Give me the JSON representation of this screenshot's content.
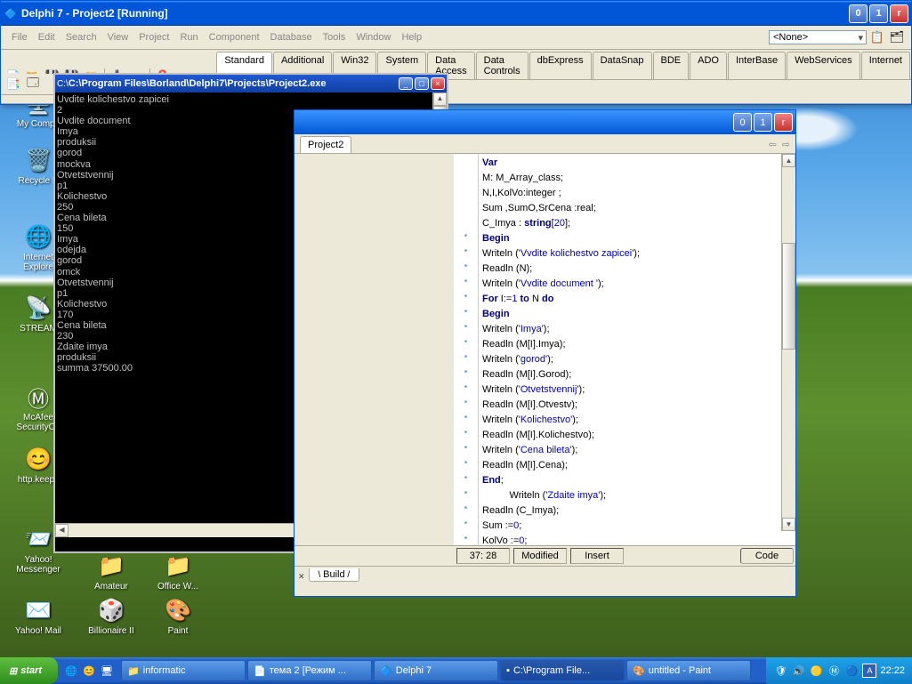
{
  "desktop": {
    "icons": [
      {
        "name": "my-computer",
        "label": "My Compu",
        "glyph": "🖥️"
      },
      {
        "name": "recycle-bin",
        "label": "Recycle B",
        "glyph": "🗑️"
      },
      {
        "name": "ie",
        "label": "Internet Explore",
        "glyph": "🌐"
      },
      {
        "name": "stream",
        "label": "STREAM",
        "glyph": "📡"
      },
      {
        "name": "mcafee",
        "label": "McAfee SecurityCe",
        "glyph": "Ⓜ"
      },
      {
        "name": "keepv",
        "label": "http.keepv",
        "glyph": "😊"
      },
      {
        "name": "ymsg",
        "label": "Yahoo! Messenger",
        "glyph": "📨"
      },
      {
        "name": "ymail",
        "label": "Yahoo! Mail",
        "glyph": "✉️"
      },
      {
        "name": "amateur",
        "label": "Amateur",
        "glyph": "📁"
      },
      {
        "name": "officew",
        "label": "Office W...",
        "glyph": "📁"
      },
      {
        "name": "billionaire",
        "label": "Billionaire II",
        "glyph": "🎲"
      },
      {
        "name": "paint",
        "label": "Paint",
        "glyph": "🎨"
      }
    ]
  },
  "delphi": {
    "title": "Delphi 7 - Project2 [Running]",
    "menu": [
      "File",
      "Edit",
      "Search",
      "View",
      "Project",
      "Run",
      "Component",
      "Database",
      "Tools",
      "Window",
      "Help"
    ],
    "dropdown": "<None>",
    "palette_tabs": [
      "Standard",
      "Additional",
      "Win32",
      "System",
      "Data Access",
      "Data Controls",
      "dbExpress",
      "DataSnap",
      "BDE",
      "ADO",
      "InterBase",
      "WebServices",
      "Internet"
    ]
  },
  "console": {
    "title": "C:\\Program Files\\Borland\\Delphi7\\Projects\\Project2.exe",
    "output": "Uvdite kolichestvo zapicei\n2\nUvdite document\nImya\nproduksii\ngorod\nmockva\nOtvetstvennij\np1\nKolichestvo\n250\nCena bileta\n150\nImya\nodejda\ngorod\nomck\nOtvetstvennij\np1\nKolichestvo\n170\nCena bileta\n230\nZdaite imya\nproduksii\nsumma 37500.00"
  },
  "editor": {
    "tab": "Project2",
    "status": {
      "pos": "37: 28",
      "mod": "Modified",
      "ins": "Insert",
      "view": "Code"
    },
    "build_tab": "Build",
    "code_lines": [
      {
        "t": "Var",
        "kw": "Var"
      },
      {
        "t": "M: M_Array_class;"
      },
      {
        "t": "N,I,KolVo:integer ;"
      },
      {
        "t": "Sum ,SumO,SrCena :real;"
      },
      {
        "t": "C_Imya : string[20];",
        "num": "20",
        "kw": "string"
      },
      {
        "t": "Begin",
        "kw": "Begin"
      },
      {
        "t": "Writeln ('Vvdite kolichestvo zapicei');",
        "str": "'Vvdite kolichestvo zapicei'"
      },
      {
        "t": "Readln (N);"
      },
      {
        "t": "Writeln ('Vvdite document ');",
        "str": "'Vvdite document '"
      },
      {
        "t": "For I:=1 to N do",
        "kw": "For",
        "kw2": "to",
        "kw3": "do",
        "num": "1"
      },
      {
        "t": "Begin",
        "kw": "Begin"
      },
      {
        "t": "Writeln ('Imya');",
        "str": "'Imya'"
      },
      {
        "t": "Readln (M[I].Imya);"
      },
      {
        "t": "Writeln ('gorod');",
        "str": "'gorod'"
      },
      {
        "t": "Readln (M[I].Gorod);"
      },
      {
        "t": "Writeln ('Otvetstvennij');",
        "str": "'Otvetstvennij'"
      },
      {
        "t": "Readln (M[I].Otvestv);"
      },
      {
        "t": "Writeln ('Kolichestvo');",
        "str": "'Kolichestvo'"
      },
      {
        "t": "Readln (M[I].Kolichestvo);"
      },
      {
        "t": "Writeln ('Cena bileta');",
        "str": "'Cena bileta'"
      },
      {
        "t": "Readln (M[I].Cena);"
      },
      {
        "t": "End;",
        "kw": "End"
      },
      {
        "t": "          Writeln ('Zdaite imya');",
        "str": "'Zdaite imya'"
      },
      {
        "t": "Readln (C_Imya);"
      },
      {
        "t": "Sum :=0;",
        "num": "0"
      },
      {
        "t": "KolVo :=0;",
        "num": "0"
      }
    ]
  },
  "taskbar": {
    "start": "start",
    "items": [
      {
        "label": "informatic",
        "glyph": "📁"
      },
      {
        "label": "тема 2 [Режим ...",
        "glyph": "📄"
      },
      {
        "label": "Delphi 7",
        "glyph": "🔷"
      },
      {
        "label": "C:\\Program File...",
        "glyph": "▪"
      },
      {
        "label": "untitled - Paint",
        "glyph": "🎨"
      }
    ],
    "clock": "22:22"
  }
}
